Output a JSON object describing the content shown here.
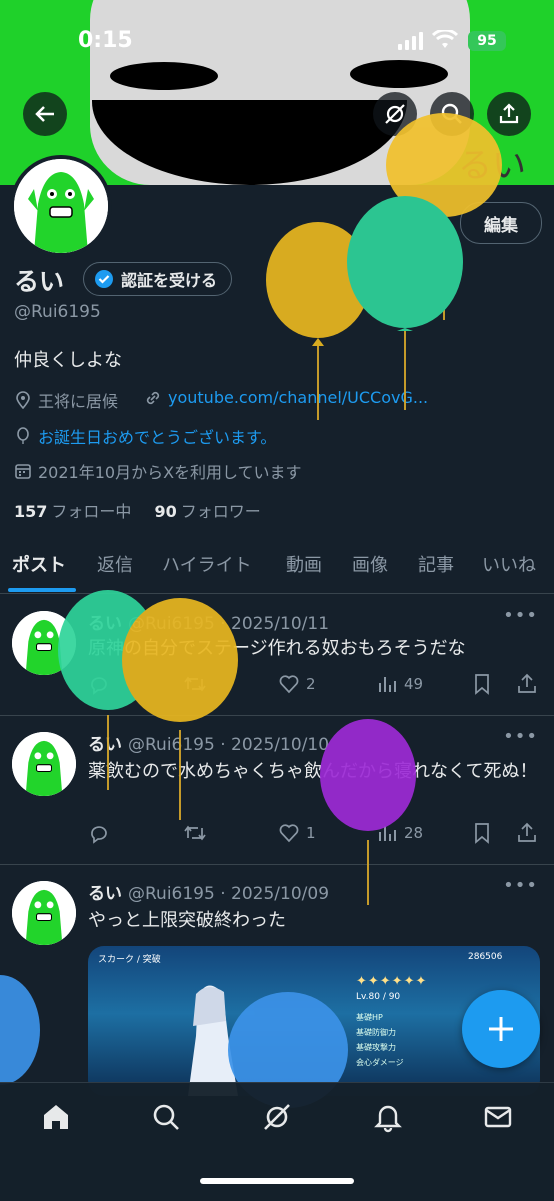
{
  "status": {
    "time": "0:15",
    "battery": "95"
  },
  "banner_text": "るい",
  "profile": {
    "name": "るい",
    "verify_label": "認証を受ける",
    "edit_label": "編集",
    "handle": "@Rui6195",
    "bio": "仲良くしよな",
    "location": "王将に居候",
    "link": "youtube.com/channel/UCCovG...",
    "birthday": "お誕生日おめでとうございます。",
    "joined": "2021年10月からXを利用しています",
    "following_count": "157",
    "following_label": "フォロー中",
    "followers_count": "90",
    "followers_label": "フォロワー"
  },
  "tabs": [
    "ポスト",
    "返信",
    "ハイライト",
    "動画",
    "画像",
    "記事",
    "いいね"
  ],
  "tweets": [
    {
      "name": "るい",
      "meta": "@Rui6195 · 2025/10/11",
      "text": "原神の自分でステージ作れる奴おもろそうだな",
      "likes": "2",
      "views": "49"
    },
    {
      "name": "るい",
      "meta": "@Rui6195 · 2025/10/10",
      "text": "薬飲むので水めちゃくちゃ飲んだから寝れなくて死ぬ！",
      "likes": "1",
      "views": "28"
    },
    {
      "name": "るい",
      "meta": "@Rui6195 · 2025/10/09",
      "text": "やっと上限突破終わった"
    }
  ],
  "media": {
    "header": "スカーク / 突破",
    "currency": "286506",
    "level": "Lv.80 / 90",
    "stats": [
      "基礎HP",
      "基礎防御力",
      "基礎攻撃力",
      "会心ダメージ"
    ]
  },
  "colors": {
    "accent": "#1d9bf0",
    "banner": "#1fd12a",
    "background": "#15202b"
  }
}
